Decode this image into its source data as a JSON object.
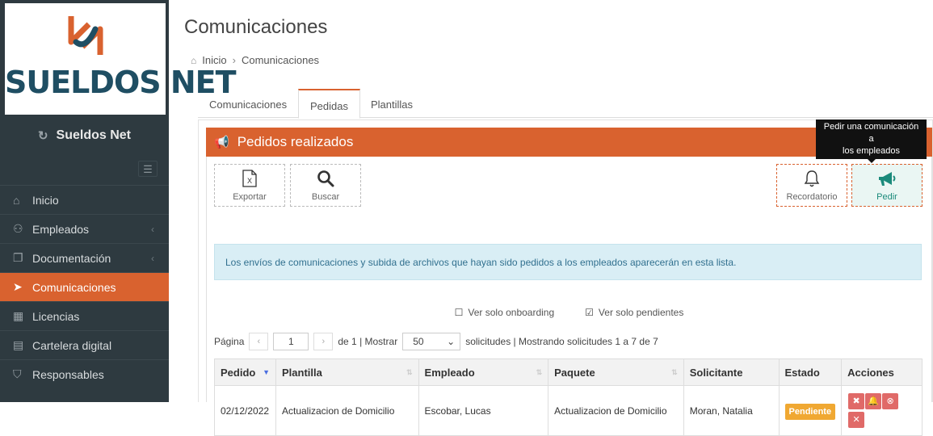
{
  "logo": {
    "text": "SUELDOS NET"
  },
  "sidebar": {
    "brand": "Sueldos Net",
    "items": [
      {
        "label": "Inicio",
        "icon": "home-icon",
        "chevron": ""
      },
      {
        "label": "Empleados",
        "icon": "users-icon",
        "chevron": "‹"
      },
      {
        "label": "Documentación",
        "icon": "documents-icon",
        "chevron": "‹"
      },
      {
        "label": "Comunicaciones",
        "icon": "paper-plane-icon",
        "chevron": ""
      },
      {
        "label": "Licencias",
        "icon": "calendar-icon",
        "chevron": ""
      },
      {
        "label": "Cartelera digital",
        "icon": "board-icon",
        "chevron": ""
      },
      {
        "label": "Responsables",
        "icon": "shield-icon",
        "chevron": ""
      }
    ],
    "active_index": 3
  },
  "page": {
    "title": "Comunicaciones",
    "breadcrumb": {
      "home": "Inicio",
      "current": "Comunicaciones"
    }
  },
  "tabs": [
    {
      "label": "Comunicaciones"
    },
    {
      "label": "Pedidas"
    },
    {
      "label": "Plantillas"
    }
  ],
  "active_tab": 1,
  "panel": {
    "title": "Pedidos realizados"
  },
  "toolbar": {
    "export_label": "Exportar",
    "search_label": "Buscar",
    "reminder_label": "Recordatorio",
    "request_label": "Pedir",
    "tooltip_line1": "Pedir una comunicación a",
    "tooltip_line2": "los empleados"
  },
  "info_text": "Los envíos de comunicaciones y subida de archivos que hayan sido pedidos a los empleados aparecerán en esta lista.",
  "filters": {
    "onboarding_label": "Ver solo onboarding",
    "onboarding_checked": false,
    "pending_label": "Ver solo pendientes",
    "pending_checked": true
  },
  "pager": {
    "page_label": "Página",
    "page": "1",
    "of_text": "de 1 | Mostrar",
    "page_size": "50",
    "summary": "solicitudes | Mostrando solicitudes 1 a 7 de 7"
  },
  "table": {
    "headers": [
      "Pedido",
      "Plantilla",
      "Empleado",
      "Paquete",
      "Solicitante",
      "Estado",
      "Acciones"
    ],
    "rows": [
      {
        "pedido": "02/12/2022",
        "plantilla": "Actualizacion de Domicilio",
        "empleado": "Escobar, Lucas",
        "paquete": "Actualizacion de Domicilio",
        "solicitante": "Moran, Natalia",
        "estado": "Pendiente"
      }
    ]
  },
  "colors": {
    "accent": "#d9622f",
    "sidebar_bg": "#2e3a40",
    "teal": "#1b8a7b",
    "badge": "#f0a832",
    "danger": "#e06a68",
    "logo_blue": "#1f4e63"
  }
}
